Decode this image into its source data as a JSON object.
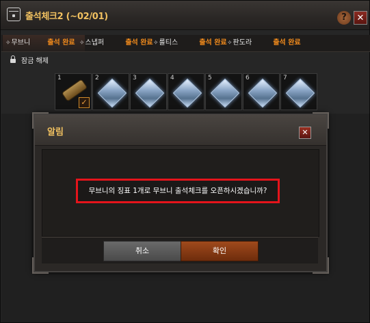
{
  "window": {
    "title": "출석체크2 (~02/01)",
    "help_label": "?",
    "close_label": "✕"
  },
  "tabs": [
    {
      "name": "무브니",
      "status": "출석 완료"
    },
    {
      "name": "스냅퍼",
      "status": "출석 완료"
    },
    {
      "name": "룰티스",
      "status": "출석 완료"
    },
    {
      "name": "판도라",
      "status": "출석 완료"
    }
  ],
  "unlock_label": "잠금 해제",
  "days": [
    {
      "num": "1",
      "icon": "scroll-icon",
      "checked": true
    },
    {
      "num": "2",
      "icon": "gem-icon",
      "checked": false
    },
    {
      "num": "3",
      "icon": "gem-icon",
      "checked": false
    },
    {
      "num": "4",
      "icon": "gem-icon",
      "checked": false
    },
    {
      "num": "5",
      "icon": "gem-icon",
      "checked": false
    },
    {
      "num": "6",
      "icon": "gem-icon",
      "checked": false
    },
    {
      "num": "7",
      "icon": "gem-icon",
      "checked": false
    }
  ],
  "dialog": {
    "title": "알림",
    "close_label": "✕",
    "message": "무브니의 징표 1개로 무브니 출석체크를 오픈하시겠습니까?",
    "cancel_label": "취소",
    "ok_label": "확인",
    "highlight_color": "#e5141b"
  },
  "colors": {
    "accent_orange": "#f08a1c",
    "title_gold": "#f0c060"
  }
}
